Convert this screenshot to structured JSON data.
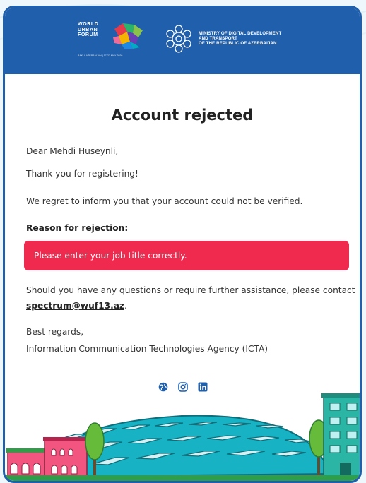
{
  "header": {
    "wuf_lines": "WORLD\nURBAN\nFORUM",
    "wuf_tagline": "BAKU, AZERBAIJAN | 17-22 MAY 2026",
    "ministry_lines": [
      "MINISTRY OF DIGITAL DEVELOPMENT",
      "AND TRANSPORT",
      "OF THE REPUBLIC OF AZERBAIJAN"
    ]
  },
  "email": {
    "title": "Account rejected",
    "greeting": "Dear Mehdi Huseynli,",
    "thanks": "Thank you for registering!",
    "regret": "We regret to inform you that your account could not be verified.",
    "reason_heading": "Reason for rejection:",
    "reason_text": "Please enter your job title correctly.",
    "contact_line": "Should you have any questions or require further assistance, please contact",
    "contact_email": "spectrum@wuf13.az",
    "contact_end": ".",
    "regards": "Best regards,",
    "signature": "Information Communication Technologies Agency (ICTA)"
  },
  "social": [
    {
      "icon": "globe-icon"
    },
    {
      "icon": "instagram-icon"
    },
    {
      "icon": "linkedin-icon"
    }
  ],
  "colors": {
    "header_blue": "#1f5fab",
    "alert_red": "#f02a4f",
    "stadium_teal": "#17b3c4",
    "building_pink": "#f2557f",
    "building_teal": "#2bb5a4"
  }
}
